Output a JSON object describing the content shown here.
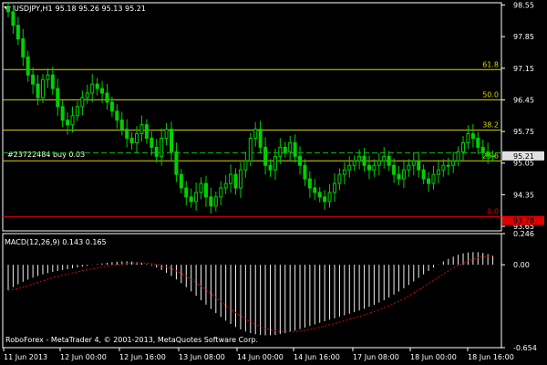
{
  "header": {
    "symbol": "USDJPY,H1",
    "ohlc": "95.18 95.26 95.13 95.21"
  },
  "order_label": "#23722484 buy 0.03",
  "macd_label": "MACD(12,26,9) 0.143 0.165",
  "footer": "RoboForex - MetaTrader 4, © 2001-2013, MetaQuotes Software Corp.",
  "colors": {
    "bull": "#00d000",
    "bear": "#00d000",
    "grid": "#3c3c3c",
    "fib": "#d7d700",
    "signal": "#e00000",
    "current_price_box": "#e0e0e0",
    "stop_box": "#e00000",
    "histogram": "#f0f0f0",
    "dashed_trade_line": "#00c000",
    "axis": "#ffffff"
  },
  "price_axis": [
    "98.55",
    "97.85",
    "97.15",
    "96.45",
    "95.75",
    "95.05",
    "94.35",
    "93.65"
  ],
  "current_price": "95.21",
  "stop_price": "93.78",
  "fib_levels": [
    {
      "label": "61.8",
      "price": 97.12
    },
    {
      "label": "50.0",
      "price": 96.45
    },
    {
      "label": "38.2",
      "price": 95.78
    },
    {
      "label": "23.6",
      "price": 95.1
    },
    {
      "label": "0.0",
      "price": 93.86
    }
  ],
  "trade_line_price": 95.28,
  "macd_axis": [
    "0.246",
    "0.00",
    "-0.654"
  ],
  "time_axis": [
    "11 Jun 2013",
    "12 Jun 00:00",
    "12 Jun 16:00",
    "13 Jun 08:00",
    "14 Jun 00:00",
    "14 Jun 16:00",
    "17 Jun 08:00",
    "18 Jun 00:00",
    "18 Jun 16:00"
  ],
  "chart_data": {
    "type": "candlestick",
    "y_range": [
      93.55,
      98.6
    ],
    "close_series": [
      98.4,
      98.1,
      97.8,
      97.4,
      97.0,
      96.8,
      96.5,
      96.9,
      97.0,
      96.7,
      96.3,
      96.0,
      95.9,
      96.1,
      96.3,
      96.5,
      96.6,
      96.8,
      96.7,
      96.6,
      96.4,
      96.2,
      96.0,
      95.8,
      95.6,
      95.5,
      95.7,
      95.9,
      95.6,
      95.4,
      95.2,
      95.6,
      95.8,
      95.3,
      94.8,
      94.5,
      94.3,
      94.2,
      94.4,
      94.6,
      94.3,
      94.1,
      94.3,
      94.5,
      94.6,
      94.8,
      94.5,
      94.9,
      95.1,
      95.6,
      95.8,
      95.4,
      95.0,
      94.9,
      95.2,
      95.4,
      95.3,
      95.5,
      95.2,
      95.0,
      94.7,
      94.5,
      94.4,
      94.3,
      94.2,
      94.4,
      94.6,
      94.8,
      94.9,
      95.0,
      95.1,
      95.2,
      95.0,
      94.9,
      95.0,
      95.1,
      95.2,
      95.0,
      94.8,
      94.7,
      94.9,
      95.0,
      95.1,
      94.9,
      94.7,
      94.6,
      94.8,
      94.9,
      95.0,
      95.0,
      95.1,
      95.3,
      95.5,
      95.7,
      95.6,
      95.4,
      95.3,
      95.2,
      95.21
    ],
    "macd_histogram_range": [
      -0.654,
      0.246
    ]
  }
}
